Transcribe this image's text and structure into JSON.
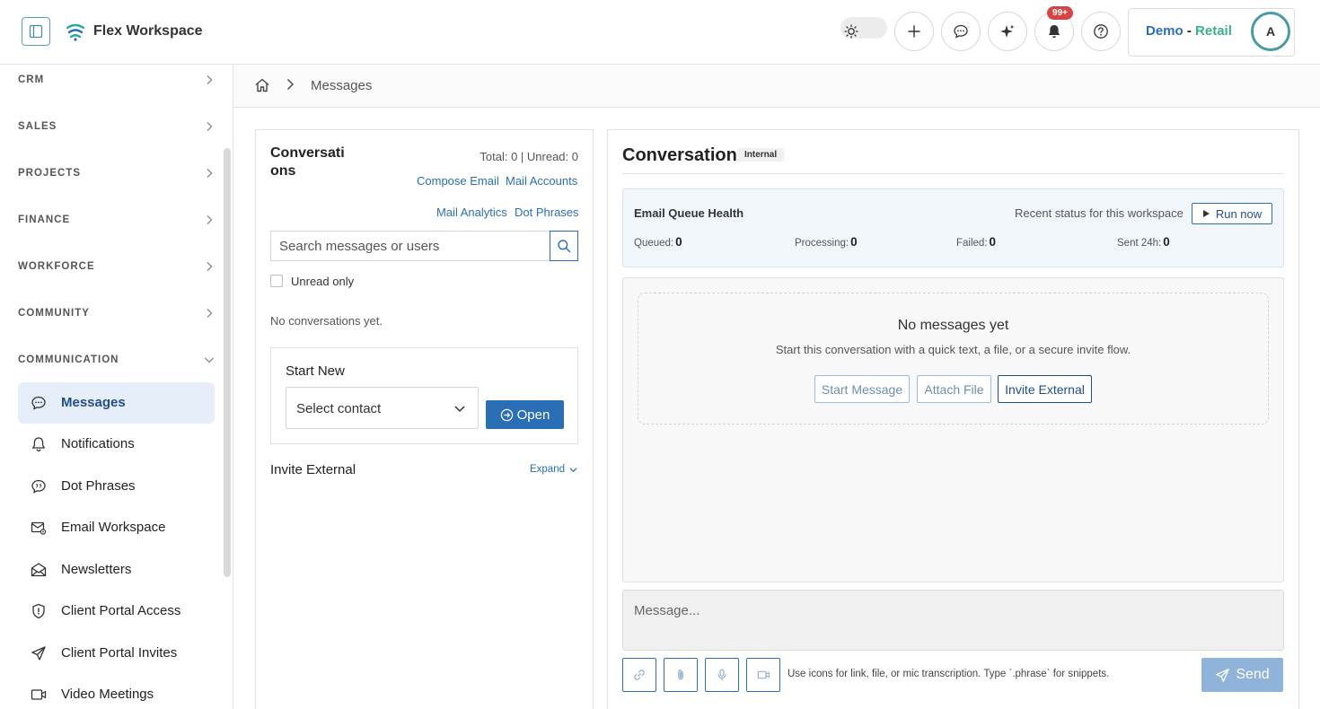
{
  "header": {
    "app_title": "Flex Workspace",
    "notification_count": "99+",
    "org_name_part1": "Demo",
    "org_name_part2": "Retail",
    "avatar_initial": "A"
  },
  "sidebar": {
    "sections": [
      {
        "label": "CRM",
        "expanded": false
      },
      {
        "label": "SALES",
        "expanded": false
      },
      {
        "label": "PROJECTS",
        "expanded": false
      },
      {
        "label": "FINANCE",
        "expanded": false
      },
      {
        "label": "WORKFORCE",
        "expanded": false
      },
      {
        "label": "COMMUNITY",
        "expanded": false
      },
      {
        "label": "COMMUNICATION",
        "expanded": true
      }
    ],
    "items": [
      {
        "label": "Messages",
        "icon": "chat-bubble-icon",
        "active": true
      },
      {
        "label": "Notifications",
        "icon": "bell-icon"
      },
      {
        "label": "Dot Phrases",
        "icon": "quote-bubble-icon"
      },
      {
        "label": "Email Workspace",
        "icon": "mail-gear-icon"
      },
      {
        "label": "Newsletters",
        "icon": "newsletter-icon"
      },
      {
        "label": "Client Portal Access",
        "icon": "shield-icon"
      },
      {
        "label": "Client Portal Invites",
        "icon": "send-icon"
      },
      {
        "label": "Video Meetings",
        "icon": "video-icon"
      }
    ]
  },
  "breadcrumb": {
    "current": "Messages"
  },
  "conversations": {
    "title": "Conversations",
    "counts": "Total: 0 | Unread: 0",
    "links": {
      "compose_email": "Compose Email",
      "mail_accounts": "Mail Accounts",
      "mail_analytics": "Mail Analytics",
      "dot_phrases": "Dot Phrases"
    },
    "search_placeholder": "Search messages or users",
    "unread_only_label": "Unread only",
    "empty_text": "No conversations yet.",
    "start_new": {
      "title": "Start New",
      "select_value": "Select contact",
      "open_label": "Open"
    },
    "invite_external": {
      "label": "Invite External",
      "expand_label": "Expand"
    }
  },
  "conversation": {
    "title": "Conversation",
    "tag": "Internal",
    "queue_health": {
      "title": "Email Queue Health",
      "subtitle": "Recent status for this workspace",
      "run_label": "Run now",
      "metrics": [
        {
          "label": "Queued:",
          "value": "0"
        },
        {
          "label": "Processing:",
          "value": "0"
        },
        {
          "label": "Failed:",
          "value": "0"
        },
        {
          "label": "Sent 24h:",
          "value": "0"
        }
      ]
    },
    "empty": {
      "title": "No messages yet",
      "subtitle": "Start this conversation with a quick text, a file, or a secure invite flow.",
      "start_message": "Start Message",
      "attach_file": "Attach File",
      "invite_external": "Invite External"
    },
    "composer_placeholder": "Message...",
    "hint": "Use icons for link, file, or mic transcription. Type `.phrase` for snippets.",
    "send_label": "Send"
  },
  "colors": {
    "accent": "#2a6fb5",
    "accent_dark": "#1f4e8a",
    "active_bg": "#e5eef9",
    "badge_red": "#d64545",
    "brand_teal": "#3cb08a"
  }
}
